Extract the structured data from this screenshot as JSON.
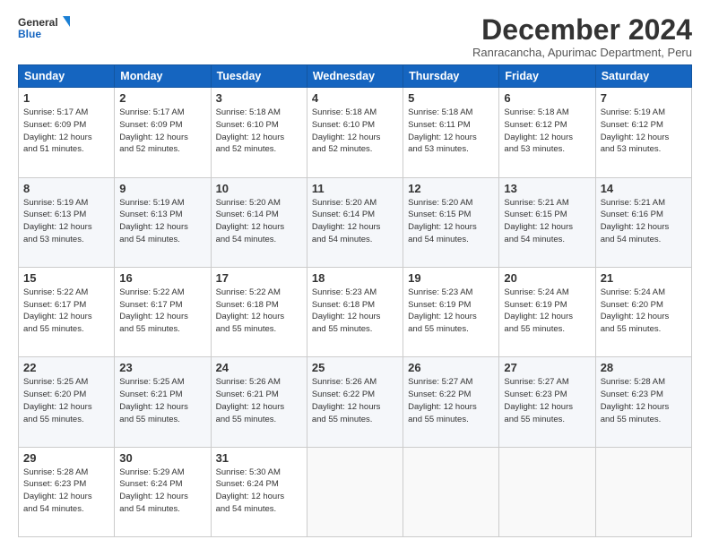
{
  "logo": {
    "line1": "General",
    "line2": "Blue"
  },
  "title": "December 2024",
  "subtitle": "Ranracancha, Apurimac Department, Peru",
  "days": [
    "Sunday",
    "Monday",
    "Tuesday",
    "Wednesday",
    "Thursday",
    "Friday",
    "Saturday"
  ],
  "weeks": [
    [
      {
        "day": "1",
        "info": "Sunrise: 5:17 AM\nSunset: 6:09 PM\nDaylight: 12 hours\nand 51 minutes."
      },
      {
        "day": "2",
        "info": "Sunrise: 5:17 AM\nSunset: 6:09 PM\nDaylight: 12 hours\nand 52 minutes."
      },
      {
        "day": "3",
        "info": "Sunrise: 5:18 AM\nSunset: 6:10 PM\nDaylight: 12 hours\nand 52 minutes."
      },
      {
        "day": "4",
        "info": "Sunrise: 5:18 AM\nSunset: 6:10 PM\nDaylight: 12 hours\nand 52 minutes."
      },
      {
        "day": "5",
        "info": "Sunrise: 5:18 AM\nSunset: 6:11 PM\nDaylight: 12 hours\nand 53 minutes."
      },
      {
        "day": "6",
        "info": "Sunrise: 5:18 AM\nSunset: 6:12 PM\nDaylight: 12 hours\nand 53 minutes."
      },
      {
        "day": "7",
        "info": "Sunrise: 5:19 AM\nSunset: 6:12 PM\nDaylight: 12 hours\nand 53 minutes."
      }
    ],
    [
      {
        "day": "8",
        "info": "Sunrise: 5:19 AM\nSunset: 6:13 PM\nDaylight: 12 hours\nand 53 minutes."
      },
      {
        "day": "9",
        "info": "Sunrise: 5:19 AM\nSunset: 6:13 PM\nDaylight: 12 hours\nand 54 minutes."
      },
      {
        "day": "10",
        "info": "Sunrise: 5:20 AM\nSunset: 6:14 PM\nDaylight: 12 hours\nand 54 minutes."
      },
      {
        "day": "11",
        "info": "Sunrise: 5:20 AM\nSunset: 6:14 PM\nDaylight: 12 hours\nand 54 minutes."
      },
      {
        "day": "12",
        "info": "Sunrise: 5:20 AM\nSunset: 6:15 PM\nDaylight: 12 hours\nand 54 minutes."
      },
      {
        "day": "13",
        "info": "Sunrise: 5:21 AM\nSunset: 6:15 PM\nDaylight: 12 hours\nand 54 minutes."
      },
      {
        "day": "14",
        "info": "Sunrise: 5:21 AM\nSunset: 6:16 PM\nDaylight: 12 hours\nand 54 minutes."
      }
    ],
    [
      {
        "day": "15",
        "info": "Sunrise: 5:22 AM\nSunset: 6:17 PM\nDaylight: 12 hours\nand 55 minutes."
      },
      {
        "day": "16",
        "info": "Sunrise: 5:22 AM\nSunset: 6:17 PM\nDaylight: 12 hours\nand 55 minutes."
      },
      {
        "day": "17",
        "info": "Sunrise: 5:22 AM\nSunset: 6:18 PM\nDaylight: 12 hours\nand 55 minutes."
      },
      {
        "day": "18",
        "info": "Sunrise: 5:23 AM\nSunset: 6:18 PM\nDaylight: 12 hours\nand 55 minutes."
      },
      {
        "day": "19",
        "info": "Sunrise: 5:23 AM\nSunset: 6:19 PM\nDaylight: 12 hours\nand 55 minutes."
      },
      {
        "day": "20",
        "info": "Sunrise: 5:24 AM\nSunset: 6:19 PM\nDaylight: 12 hours\nand 55 minutes."
      },
      {
        "day": "21",
        "info": "Sunrise: 5:24 AM\nSunset: 6:20 PM\nDaylight: 12 hours\nand 55 minutes."
      }
    ],
    [
      {
        "day": "22",
        "info": "Sunrise: 5:25 AM\nSunset: 6:20 PM\nDaylight: 12 hours\nand 55 minutes."
      },
      {
        "day": "23",
        "info": "Sunrise: 5:25 AM\nSunset: 6:21 PM\nDaylight: 12 hours\nand 55 minutes."
      },
      {
        "day": "24",
        "info": "Sunrise: 5:26 AM\nSunset: 6:21 PM\nDaylight: 12 hours\nand 55 minutes."
      },
      {
        "day": "25",
        "info": "Sunrise: 5:26 AM\nSunset: 6:22 PM\nDaylight: 12 hours\nand 55 minutes."
      },
      {
        "day": "26",
        "info": "Sunrise: 5:27 AM\nSunset: 6:22 PM\nDaylight: 12 hours\nand 55 minutes."
      },
      {
        "day": "27",
        "info": "Sunrise: 5:27 AM\nSunset: 6:23 PM\nDaylight: 12 hours\nand 55 minutes."
      },
      {
        "day": "28",
        "info": "Sunrise: 5:28 AM\nSunset: 6:23 PM\nDaylight: 12 hours\nand 55 minutes."
      }
    ],
    [
      {
        "day": "29",
        "info": "Sunrise: 5:28 AM\nSunset: 6:23 PM\nDaylight: 12 hours\nand 54 minutes."
      },
      {
        "day": "30",
        "info": "Sunrise: 5:29 AM\nSunset: 6:24 PM\nDaylight: 12 hours\nand 54 minutes."
      },
      {
        "day": "31",
        "info": "Sunrise: 5:30 AM\nSunset: 6:24 PM\nDaylight: 12 hours\nand 54 minutes."
      },
      null,
      null,
      null,
      null
    ]
  ]
}
